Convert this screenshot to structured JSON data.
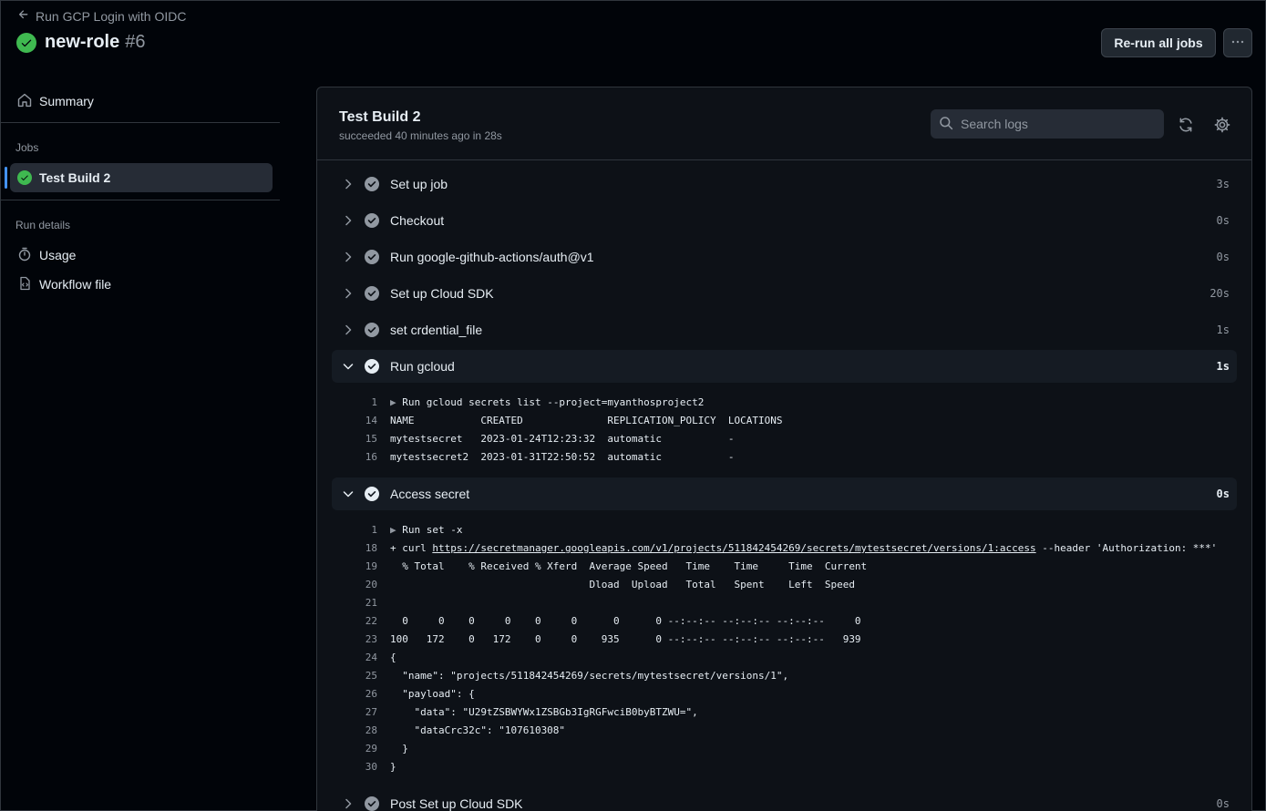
{
  "header": {
    "back_label": "Run GCP Login with OIDC",
    "run_title": "new-role",
    "run_number": "#6",
    "rerun_label": "Re-run all jobs"
  },
  "sidebar": {
    "summary_label": "Summary",
    "jobs_heading": "Jobs",
    "job_label": "Test Build 2",
    "run_details_heading": "Run details",
    "usage_label": "Usage",
    "workflow_label": "Workflow file"
  },
  "job": {
    "title": "Test Build 2",
    "subtitle": "succeeded 40 minutes ago in 28s",
    "search_placeholder": "Search logs"
  },
  "steps": [
    {
      "name": "Set up job",
      "duration": "3s"
    },
    {
      "name": "Checkout",
      "duration": "0s"
    },
    {
      "name": "Run google-github-actions/auth@v1",
      "duration": "0s"
    },
    {
      "name": "Set up Cloud SDK",
      "duration": "20s"
    },
    {
      "name": "set crdential_file",
      "duration": "1s"
    },
    {
      "name": "Run gcloud",
      "duration": "1s"
    },
    {
      "name": "Access secret",
      "duration": "0s"
    },
    {
      "name": "Post Set up Cloud SDK",
      "duration": "0s"
    }
  ],
  "gcloud_log": [
    {
      "n": "1",
      "text": "Run gcloud secrets list --project=myanthosproject2"
    },
    {
      "n": "14",
      "text": "NAME           CREATED              REPLICATION_POLICY  LOCATIONS"
    },
    {
      "n": "15",
      "text": "mytestsecret   2023-01-24T12:23:32  automatic           -"
    },
    {
      "n": "16",
      "text": "mytestsecret2  2023-01-31T22:50:52  automatic           -"
    }
  ],
  "access_log": [
    {
      "n": "1",
      "text": "Run set -x"
    },
    {
      "n": "18",
      "prefix": "+ curl ",
      "link": "https://secretmanager.googleapis.com/v1/projects/511842454269/secrets/mytestsecret/versions/1:access",
      "suffix": " --header 'Authorization: ***'"
    },
    {
      "n": "19",
      "text": "  % Total    % Received % Xferd  Average Speed   Time    Time     Time  Current"
    },
    {
      "n": "20",
      "text": "                                 Dload  Upload   Total   Spent    Left  Speed"
    },
    {
      "n": "21",
      "text": ""
    },
    {
      "n": "22",
      "text": "  0     0    0     0    0     0      0      0 --:--:-- --:--:-- --:--:--     0"
    },
    {
      "n": "23",
      "text": "100   172    0   172    0     0    935      0 --:--:-- --:--:-- --:--:--   939"
    },
    {
      "n": "24",
      "text": "{"
    },
    {
      "n": "25",
      "text": "  \"name\": \"projects/511842454269/secrets/mytestsecret/versions/1\","
    },
    {
      "n": "26",
      "text": "  \"payload\": {"
    },
    {
      "n": "27",
      "text": "    \"data\": \"U29tZSBWYWx1ZSBGb3IgRGFwciB0byBTZWU=\","
    },
    {
      "n": "28",
      "text": "    \"dataCrc32c\": \"107610308\""
    },
    {
      "n": "29",
      "text": "  }"
    },
    {
      "n": "30",
      "text": "}"
    }
  ],
  "colors": {
    "success": "#3fb950",
    "accent": "#4493f8",
    "background": "#010409",
    "panel": "#0d1117"
  }
}
